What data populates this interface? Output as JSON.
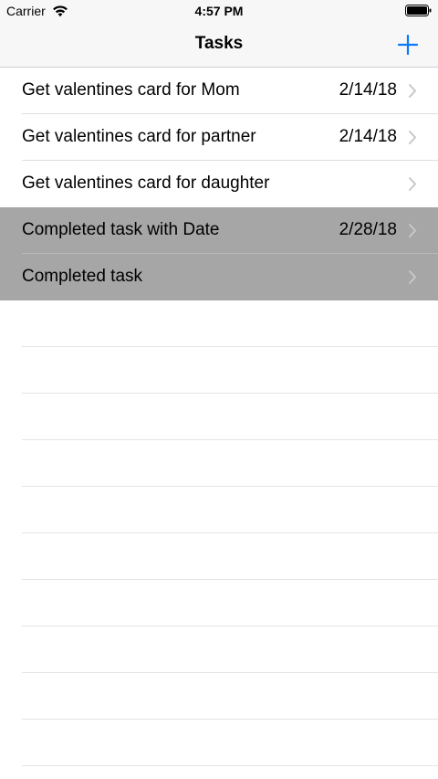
{
  "status_bar": {
    "carrier": "Carrier",
    "time": "4:57 PM",
    "wifi_icon": "wifi-icon",
    "battery_icon": "battery-full-icon"
  },
  "nav": {
    "title": "Tasks",
    "add_icon": "plus-icon",
    "accent_color": "#0a7aff"
  },
  "tasks": [
    {
      "title": "Get valentines card for Mom",
      "date": "2/14/18",
      "completed": false
    },
    {
      "title": "Get valentines card for partner",
      "date": "2/14/18",
      "completed": false
    },
    {
      "title": "Get valentines card for daughter",
      "date": "",
      "completed": false
    },
    {
      "title": "Completed task with Date",
      "date": "2/28/18",
      "completed": true
    },
    {
      "title": "Completed task",
      "date": "",
      "completed": true
    }
  ],
  "colors": {
    "completed_row_background": "#a6a6a6",
    "separator": "#dcdcde",
    "chevron": "#c7c7cc"
  }
}
